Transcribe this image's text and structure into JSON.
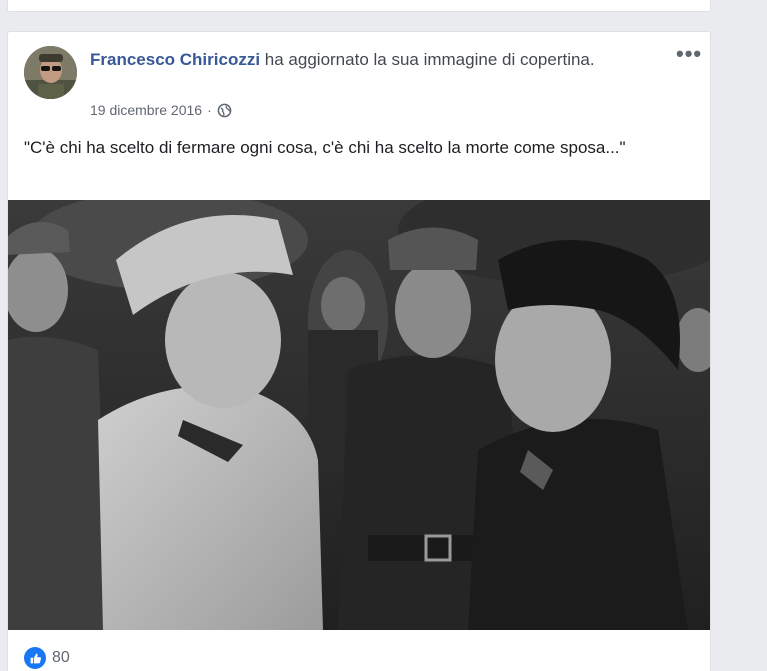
{
  "post": {
    "author": "Francesco Chiricozzi",
    "action": "ha aggiornato la sua immagine di copertina.",
    "date": "19 dicembre 2016",
    "date_separator": "·",
    "privacy_icon": "globe-icon",
    "more_label": "•••",
    "caption": "\"C'è chi ha scelto di fermare ogni cosa, c'è chi ha scelto la morte come sposa...\"",
    "photo_description_icon": "cover-photo",
    "reactions": {
      "icon": "like-icon",
      "count": "80"
    }
  },
  "colors": {
    "author": "#385898",
    "like": "#1877f2",
    "page_bg": "#e9ebee"
  }
}
